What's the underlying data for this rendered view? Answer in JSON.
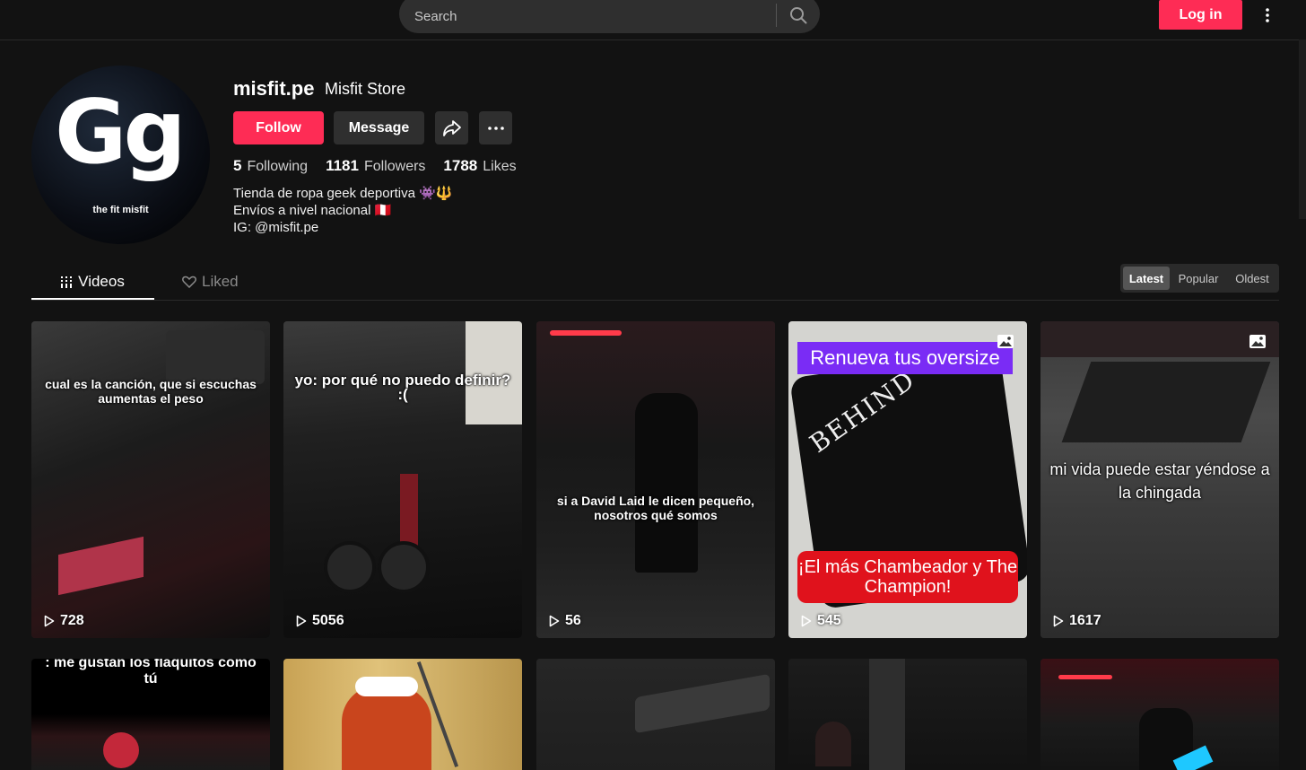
{
  "search": {
    "placeholder": "Search"
  },
  "header": {
    "login_label": "Log in"
  },
  "profile": {
    "username": "misfit.pe",
    "nickname": "Misfit Store",
    "avatar_mark": "Gg",
    "avatar_tagline": "the fit misfit",
    "follow_label": "Follow",
    "message_label": "Message",
    "stats": [
      {
        "value": "5",
        "label": "Following"
      },
      {
        "value": "1181",
        "label": "Followers"
      },
      {
        "value": "1788",
        "label": "Likes"
      }
    ],
    "bio": [
      "Tienda de ropa geek deportiva 👾🔱",
      "Envíos a nivel nacional 🇵🇪",
      "IG: @misfit.pe"
    ]
  },
  "tabs": {
    "videos": "Videos",
    "liked": "Liked"
  },
  "sort": {
    "latest": "Latest",
    "popular": "Popular",
    "oldest": "Oldest",
    "selected": "Latest"
  },
  "videos": [
    {
      "caption": "cual es la canción, que si escuchas aumentas el peso",
      "views": "728"
    },
    {
      "caption": "yo: por qué no puedo definir? :(",
      "views": "5056"
    },
    {
      "caption": "si a David Laid le dicen pequeño, nosotros qué somos",
      "views": "56"
    },
    {
      "caption": "Renueva tus oversize",
      "caption2": "¡El más Chambeador y The Champion!",
      "shirt_text": "BEHIND",
      "views": "545",
      "is_photo": true
    },
    {
      "caption": "mi vida puede estar yéndose a la chingada",
      "views": "1617",
      "is_photo": true
    },
    {
      "caption": ": me gustan los flaquitos como tú"
    },
    {
      "caption": ""
    },
    {
      "caption": ""
    },
    {
      "caption": ""
    },
    {
      "caption": ""
    }
  ],
  "colors": {
    "accent": "#fe2c55",
    "background": "#121212",
    "surface": "#2f2f2f"
  }
}
